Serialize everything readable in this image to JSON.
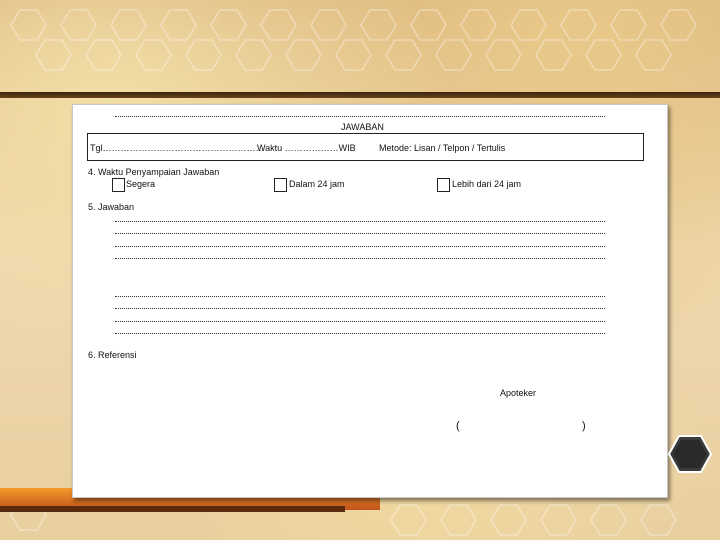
{
  "form": {
    "title": "JAWABAN",
    "tgl_label": "Tgl………………………………………………",
    "waktu_label": "Waktu ………………WIB",
    "metode_label": "Metode: Lisan / Telpon / Tertulis",
    "section4_title": "4. Waktu Penyampaian Jawaban",
    "opt_segera": "Segera",
    "opt_dalam24": "Dalam 24 jam",
    "opt_lebih24": "Lebih dari 24 jam",
    "section5_title": "5. Jawaban",
    "section6_title": "6. Referensi",
    "signer_label": "Apoteker",
    "paren_open": "(",
    "paren_close": ")"
  },
  "nav": {
    "hex_icon": "hexagon-icon"
  },
  "colors": {
    "accent": "#f59a2a",
    "band": "#3a2410",
    "paper": "#ffffff"
  }
}
